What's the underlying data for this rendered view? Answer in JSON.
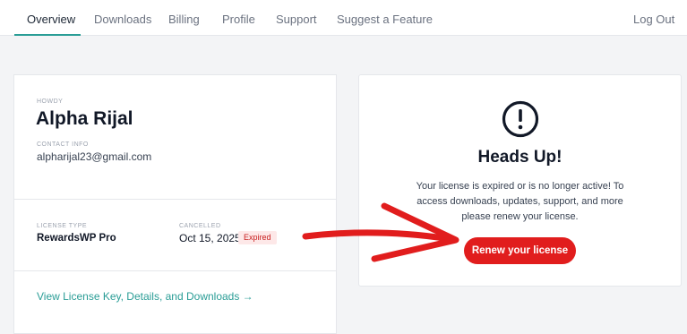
{
  "nav": {
    "tabs": [
      {
        "label": "Overview"
      },
      {
        "label": "Downloads"
      },
      {
        "label": "Billing"
      },
      {
        "label": "Profile"
      },
      {
        "label": "Support"
      },
      {
        "label": "Suggest a Feature"
      }
    ],
    "logout_label": "Log Out"
  },
  "account": {
    "howdy_label": "HOWDY",
    "name": "Alpha Rijal",
    "contact_label": "CONTACT INFO",
    "email": "alpharijal23@gmail.com"
  },
  "license": {
    "type_label": "LICENSE TYPE",
    "type_value": "RewardsWP Pro",
    "status_label": "CANCELLED",
    "date": "Oct 15, 2025",
    "badge": "Expired",
    "link_label": "View License Key, Details, and Downloads →"
  },
  "alert": {
    "icon": "exclamation-circle-icon",
    "title": "Heads Up!",
    "message_line1": "Your license is expired or is no longer active! To",
    "message_line2": "access downloads, updates, support, and more",
    "message_line3": "please renew your license.",
    "button_label": "Renew your license"
  },
  "colors": {
    "accent": "#2a9d96",
    "danger": "#e11d1d",
    "badge_bg": "#fde8e8",
    "arrow": "#e11d1d"
  }
}
